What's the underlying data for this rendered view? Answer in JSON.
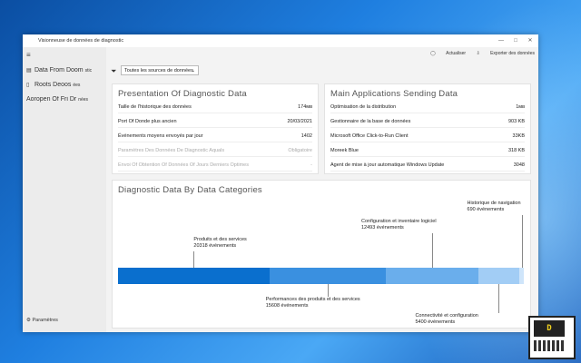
{
  "window": {
    "title": "Visionneuse de données de diagnostic",
    "controls": [
      "—",
      "□",
      "✕"
    ]
  },
  "sidebar": {
    "items": [
      {
        "label": "Data From Doom",
        "suffix": "stic",
        "icon": "chart-icon"
      },
      {
        "label": "Roots Deoos",
        "suffix": "ées",
        "icon": "document-icon"
      },
      {
        "label": "Aoropen Of Fri Dr",
        "suffix": "nées",
        "icon": "history-icon"
      }
    ],
    "settings_label": "Paramètres"
  },
  "toolbar": {
    "refresh_label": "Actualiser",
    "export_label": "Exporter des données",
    "filter_value": "Toutes les sources de données"
  },
  "overview": {
    "title": "Presentation Of Diagnostic Data",
    "rows": [
      {
        "label": "Taille de l'historique des données",
        "value": "174мв"
      },
      {
        "label": "Port Of Donde plus ancien",
        "value": "20/03/2021"
      },
      {
        "label": "Événements moyens envoyés par jour",
        "value": "1402"
      },
      {
        "label": "Paramètres Des Données De Diagnostic Aquals",
        "value": "Obligatoire",
        "faded": true
      },
      {
        "label": "Envoi Of Obtention Of Données Of Jours Derniers Optimes",
        "value": "-",
        "faded": true
      }
    ]
  },
  "apps": {
    "title": "Main Applications Sending Data",
    "rows": [
      {
        "label": "Optimisation de la distribution",
        "value": "1мв"
      },
      {
        "label": "Gestionnaire de la base de données",
        "value": "903 KB"
      },
      {
        "label": "Microsoft Office Click-to-Run Client",
        "value": "33KB"
      },
      {
        "label": "Moreek Blue",
        "value": "318 KB"
      },
      {
        "label": "Agent de mise à jour automatique Windows Update",
        "value": "3048"
      }
    ]
  },
  "categories": {
    "title": "Diagnostic Data By Data Categories",
    "segments": [
      {
        "name": "Produits et des services",
        "count": "20318 événements",
        "fraction": 0.369,
        "color": "#0a6fce"
      },
      {
        "name": "Performances des produits et des services",
        "count": "15608 événements",
        "fraction": 0.283,
        "color": "#3a90e0"
      },
      {
        "name": "Configuration et inventaire logiciel",
        "count": "12493 événements",
        "fraction": 0.227,
        "color": "#6aaeec"
      },
      {
        "name": "Connectivité et configuration",
        "count": "5400 événements",
        "fraction": 0.098,
        "color": "#a2cdf5"
      },
      {
        "name": "Historique de navigation",
        "count": "690 événements",
        "fraction": 0.013,
        "color": "#cfe5fa"
      }
    ]
  },
  "watermark": {
    "text": "D"
  }
}
